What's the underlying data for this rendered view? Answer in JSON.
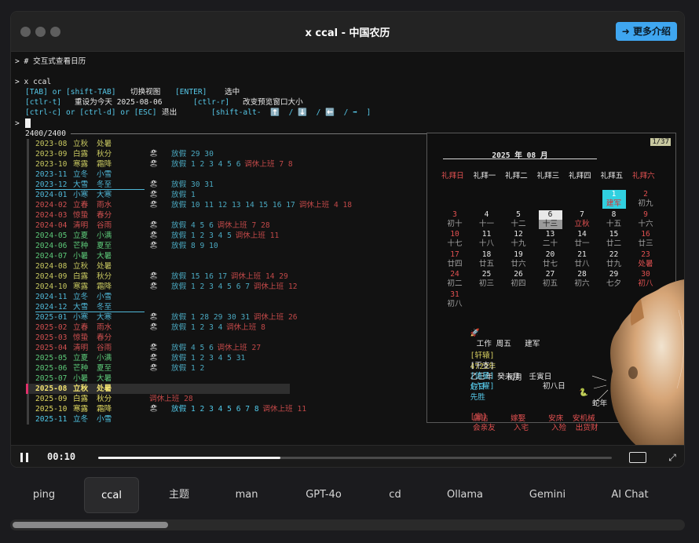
{
  "window": {
    "title": "x ccal - 中国农历",
    "more_button": "➜ 更多介绍"
  },
  "terminal": {
    "comment_line": "> # 交互式查看日历",
    "command_line": "> x ccal",
    "help": {
      "l1_k1": "[TAB] or [shift-TAB]",
      "l1_v1": "切换视图",
      "l1_k2": "[ENTER]",
      "l1_v2": "选中",
      "l2_k1": "[ctlr-t]",
      "l2_v1": "重设为今天 2025-08-06",
      "l2_k2": "[ctlr-r]",
      "l2_v2": "改变预览窗口大小",
      "l3_k1": "[ctrl-c] or [ctrl-d] or [ESC]",
      "l3_v1": "退出",
      "l3_k2": "[shift-alt-  ⬆️  / ⬇️  / ⬅️  / ➡  ]"
    },
    "prompt": ">",
    "counter": "2400/2400",
    "rows": [
      {
        "ym": "2023-08",
        "t1": "立秋",
        "t2": "处暑",
        "icon": "",
        "hol": "",
        "wk": "",
        "c": "#c8c860",
        "under": false
      },
      {
        "ym": "2023-09",
        "t1": "白露",
        "t2": "秋分",
        "icon": "🏖",
        "hol": "放假 29 30",
        "wk": "",
        "c": "#c8c860",
        "under": false
      },
      {
        "ym": "2023-10",
        "t1": "寒露",
        "t2": "霜降",
        "icon": "🏖",
        "hol": "放假 1 2 3 4 5 6",
        "wk": "调休上班 7 8",
        "c": "#c8c860",
        "under": false
      },
      {
        "ym": "2023-11",
        "t1": "立冬",
        "t2": "小雪",
        "icon": "",
        "hol": "",
        "wk": "",
        "c": "#50b8d8",
        "under": false
      },
      {
        "ym": "2023-12",
        "t1": "大雪",
        "t2": "冬至",
        "icon": "🏖",
        "hol": "放假 30 31",
        "wk": "",
        "c": "#50b8d8",
        "under": true
      },
      {
        "ym": "2024-01",
        "t1": "小寒",
        "t2": "大寒",
        "icon": "🏖",
        "hol": "放假 1",
        "wk": "",
        "c": "#50b8d8",
        "under": false
      },
      {
        "ym": "2024-02",
        "t1": "立春",
        "t2": "雨水",
        "icon": "🏖",
        "hol": "放假 10 11 12 13 14 15 16 17",
        "wk": "调休上班 4 18",
        "c": "#d05050",
        "under": false
      },
      {
        "ym": "2024-03",
        "t1": "惊蛰",
        "t2": "春分",
        "icon": "",
        "hol": "",
        "wk": "",
        "c": "#d05050",
        "under": false
      },
      {
        "ym": "2024-04",
        "t1": "清明",
        "t2": "谷雨",
        "icon": "🏖",
        "hol": "放假 4 5 6",
        "wk": "调休上班 7 28",
        "c": "#d05050",
        "under": false
      },
      {
        "ym": "2024-05",
        "t1": "立夏",
        "t2": "小满",
        "icon": "🏖",
        "hol": "放假 1 2 3 4 5",
        "wk": "调休上班 11",
        "c": "#5cc878",
        "under": false
      },
      {
        "ym": "2024-06",
        "t1": "芒种",
        "t2": "夏至",
        "icon": "🏖",
        "hol": "放假 8 9 10",
        "wk": "",
        "c": "#5cc878",
        "under": false
      },
      {
        "ym": "2024-07",
        "t1": "小暑",
        "t2": "大暑",
        "icon": "",
        "hol": "",
        "wk": "",
        "c": "#5cc878",
        "under": false
      },
      {
        "ym": "2024-08",
        "t1": "立秋",
        "t2": "处暑",
        "icon": "",
        "hol": "",
        "wk": "",
        "c": "#c8c860",
        "under": false
      },
      {
        "ym": "2024-09",
        "t1": "白露",
        "t2": "秋分",
        "icon": "🏖",
        "hol": "放假 15 16 17",
        "wk": "调休上班 14 29",
        "c": "#c8c860",
        "under": false
      },
      {
        "ym": "2024-10",
        "t1": "寒露",
        "t2": "霜降",
        "icon": "🏖",
        "hol": "放假 1 2 3 4 5 6 7",
        "wk": "调休上班 12",
        "c": "#c8c860",
        "under": false
      },
      {
        "ym": "2024-11",
        "t1": "立冬",
        "t2": "小雪",
        "icon": "",
        "hol": "",
        "wk": "",
        "c": "#50b8d8",
        "under": false
      },
      {
        "ym": "2024-12",
        "t1": "大雪",
        "t2": "冬至",
        "icon": "",
        "hol": "",
        "wk": "",
        "c": "#50b8d8",
        "under": true
      },
      {
        "ym": "2025-01",
        "t1": "小寒",
        "t2": "大寒",
        "icon": "🏖",
        "hol": "放假 1 28 29 30 31",
        "wk": "调休上班 26",
        "c": "#50b8d8",
        "under": false
      },
      {
        "ym": "2025-02",
        "t1": "立春",
        "t2": "雨水",
        "icon": "🏖",
        "hol": "放假 1 2 3 4",
        "wk": "调休上班 8",
        "c": "#d05050",
        "under": false
      },
      {
        "ym": "2025-03",
        "t1": "惊蛰",
        "t2": "春分",
        "icon": "",
        "hol": "",
        "wk": "",
        "c": "#d05050",
        "under": false
      },
      {
        "ym": "2025-04",
        "t1": "清明",
        "t2": "谷雨",
        "icon": "🏖",
        "hol": "放假 4 5 6",
        "wk": "调休上班 27",
        "c": "#d05050",
        "under": false
      },
      {
        "ym": "2025-05",
        "t1": "立夏",
        "t2": "小满",
        "icon": "🏖",
        "hol": "放假 1 2 3 4 5 31",
        "wk": "",
        "c": "#5cc878",
        "under": false
      },
      {
        "ym": "2025-06",
        "t1": "芒种",
        "t2": "夏至",
        "icon": "🏖",
        "hol": "放假 1 2",
        "wk": "",
        "c": "#5cc878",
        "under": false
      },
      {
        "ym": "2025-07",
        "t1": "小暑",
        "t2": "大暑",
        "icon": "",
        "hol": "",
        "wk": "",
        "c": "#5cc878",
        "under": false
      },
      {
        "ym": "2025-08",
        "t1": "立秋",
        "t2": "处暑",
        "icon": "",
        "hol": "",
        "wk": "",
        "c": "#f0e070",
        "under": false,
        "selected": true
      },
      {
        "ym": "2025-09",
        "t1": "白露",
        "t2": "秋分",
        "icon": "",
        "hol": "",
        "wk": "调休上班 28",
        "c": "#e0d860",
        "under": false
      },
      {
        "ym": "2025-10",
        "t1": "寒露",
        "t2": "霜降",
        "icon": "🏖",
        "hol": "放假 1 2 3 4 5 6 7 8",
        "wk": "调休上班 11",
        "c": "#e0d860",
        "under": false
      },
      {
        "ym": "2025-11",
        "t1": "立冬",
        "t2": "小雪",
        "icon": "",
        "hol": "",
        "wk": "",
        "c": "#50c8e8",
        "under": false
      }
    ]
  },
  "calendar": {
    "page": "1/37",
    "header": "2025 年 08 月",
    "weekdays": [
      "礼拜日",
      "礼拜一",
      "礼拜二",
      "礼拜三",
      "礼拜四",
      "礼拜五",
      "礼拜六"
    ],
    "days": [
      {
        "n": "1",
        "l": "建军",
        "col": 5,
        "row": 0,
        "sel": true
      },
      {
        "n": "2",
        "l": "初九",
        "col": 6,
        "row": 0
      },
      {
        "n": "3",
        "l": "初十",
        "col": 0,
        "row": 1
      },
      {
        "n": "4",
        "l": "十一",
        "col": 1,
        "row": 1
      },
      {
        "n": "5",
        "l": "十二",
        "col": 2,
        "row": 1
      },
      {
        "n": "6",
        "l": "十三",
        "col": 3,
        "row": 1,
        "today": true
      },
      {
        "n": "7",
        "l": "立秋",
        "col": 4,
        "row": 1,
        "lred": true
      },
      {
        "n": "8",
        "l": "十五",
        "col": 5,
        "row": 1
      },
      {
        "n": "9",
        "l": "十六",
        "col": 6,
        "row": 1
      },
      {
        "n": "10",
        "l": "十七",
        "col": 0,
        "row": 2
      },
      {
        "n": "11",
        "l": "十八",
        "col": 1,
        "row": 2
      },
      {
        "n": "12",
        "l": "十九",
        "col": 2,
        "row": 2
      },
      {
        "n": "13",
        "l": "二十",
        "col": 3,
        "row": 2
      },
      {
        "n": "14",
        "l": "廿一",
        "col": 4,
        "row": 2
      },
      {
        "n": "15",
        "l": "廿二",
        "col": 5,
        "row": 2
      },
      {
        "n": "16",
        "l": "廿三",
        "col": 6,
        "row": 2
      },
      {
        "n": "17",
        "l": "廿四",
        "col": 0,
        "row": 3
      },
      {
        "n": "18",
        "l": "廿五",
        "col": 1,
        "row": 3
      },
      {
        "n": "19",
        "l": "廿六",
        "col": 2,
        "row": 3
      },
      {
        "n": "20",
        "l": "廿七",
        "col": 3,
        "row": 3
      },
      {
        "n": "21",
        "l": "廿八",
        "col": 4,
        "row": 3
      },
      {
        "n": "22",
        "l": "廿九",
        "col": 5,
        "row": 3
      },
      {
        "n": "23",
        "l": "处暑",
        "col": 6,
        "row": 3,
        "lred": true
      },
      {
        "n": "24",
        "l": "闰月",
        "col": 0,
        "row": 4
      },
      {
        "n": "25",
        "l": "初二",
        "col": 1,
        "row": 4
      },
      {
        "n": "26",
        "l": "初三",
        "col": 2,
        "row": 4
      },
      {
        "n": "27",
        "l": "初四",
        "col": 3,
        "row": 4
      },
      {
        "n": "28",
        "l": "初五",
        "col": 4,
        "row": 4
      },
      {
        "n": "29",
        "l": "初六",
        "col": 5,
        "row": 4
      },
      {
        "n": "30",
        "l": "七夕",
        "col": 6,
        "row": 4,
        "lred": true
      },
      {
        "n": "31",
        "l": "初八",
        "col": 0,
        "row": 5
      }
    ],
    "lunar_row5": [
      "初二",
      "初三",
      "初四",
      "初五",
      "初六",
      "七夕",
      "初八"
    ],
    "work_line": {
      "icon": "🚀",
      "text": "工作 周五   建军"
    },
    "xuanyuan_label": "[轩辕]",
    "xuanyuan_val": "4722年",
    "leap_month": "闰月",
    "lunar_day": "初八日",
    "zodiac_icon": "🐍",
    "zodiac": "蛇年",
    "ganzhi_label": "[干支]",
    "ganzhi_val": "乙巳年 癸未月  壬寅日",
    "zhixing_label": "[值星]",
    "zhixing_val": "危日",
    "liuyao_label": "[六曜]",
    "liuyao_val": "先胜",
    "yi_label": "[宜]",
    "yi_row1": "会亲友    入宅     入殓  出货财",
    "yi_row2": "启钻     嫁娶     安床  安机械"
  },
  "player": {
    "time": "00:10",
    "progress": 0.355
  },
  "tabs": [
    "ping",
    "ccal",
    "主题",
    "man",
    "GPT-4o",
    "cd",
    "Ollama",
    "Gemini",
    "AI Chat"
  ],
  "active_tab": "ccal",
  "colors": {
    "accent": "#3fa6f0",
    "cyan": "#56c8e8",
    "red": "#e05050",
    "select": "#30d0e0"
  }
}
